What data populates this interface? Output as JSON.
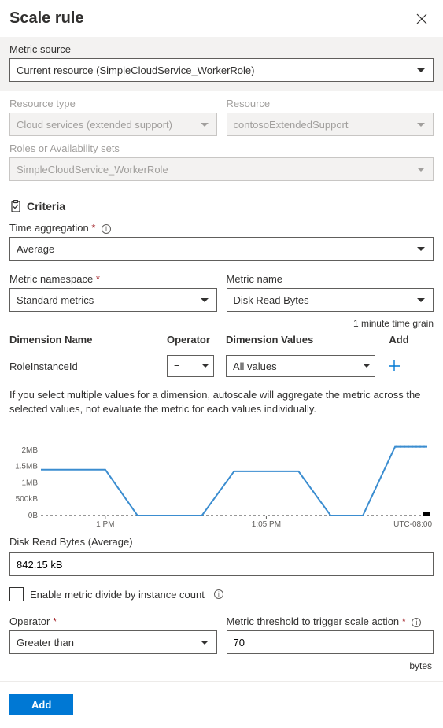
{
  "header": {
    "title": "Scale rule"
  },
  "metricSource": {
    "label": "Metric source",
    "value": "Current resource (SimpleCloudService_WorkerRole)"
  },
  "resourceType": {
    "label": "Resource type",
    "value": "Cloud services (extended support)"
  },
  "resource": {
    "label": "Resource",
    "value": "contosoExtendedSupport"
  },
  "roles": {
    "label": "Roles or Availability sets",
    "value": "SimpleCloudService_WorkerRole"
  },
  "criteria": {
    "title": "Criteria"
  },
  "timeAgg": {
    "label": "Time aggregation",
    "value": "Average"
  },
  "metricNs": {
    "label": "Metric namespace",
    "value": "Standard metrics"
  },
  "metricName": {
    "label": "Metric name",
    "value": "Disk Read Bytes"
  },
  "timeGrain": "1 minute time grain",
  "dimTable": {
    "headers": {
      "name": "Dimension Name",
      "op": "Operator",
      "values": "Dimension Values",
      "add": "Add"
    },
    "row": {
      "name": "RoleInstanceId",
      "op": "=",
      "values": "All values"
    }
  },
  "note": "If you select multiple values for a dimension, autoscale will aggregate the metric across the selected values, not evaluate the metric for each values individually.",
  "chart_data": {
    "type": "line",
    "title": "",
    "xlabel": "",
    "ylabel": "",
    "y_ticks": [
      "0B",
      "500kB",
      "1MB",
      "1.5MB",
      "2MB"
    ],
    "ylim": [
      0,
      2500000
    ],
    "x_ticks": [
      "1 PM",
      "1:05 PM"
    ],
    "tz": "UTC-08:00",
    "series": [
      {
        "name": "Disk Read Bytes",
        "points": [
          {
            "t": "12:58",
            "v": 1400000
          },
          {
            "t": "12:59",
            "v": 1400000
          },
          {
            "t": "1:00",
            "v": 1400000
          },
          {
            "t": "1:01",
            "v": 0
          },
          {
            "t": "1:02",
            "v": 0
          },
          {
            "t": "1:03",
            "v": 0
          },
          {
            "t": "1:04",
            "v": 1350000
          },
          {
            "t": "1:05",
            "v": 1350000
          },
          {
            "t": "1:06",
            "v": 1350000
          },
          {
            "t": "1:07",
            "v": 0
          },
          {
            "t": "1:08",
            "v": 0
          },
          {
            "t": "1:09",
            "v": 2100000
          },
          {
            "t": "1:10",
            "v": 2100000
          }
        ]
      }
    ]
  },
  "metricReadout": {
    "label": "Disk Read Bytes (Average)",
    "value": "842.15 kB"
  },
  "divideCheck": {
    "label": "Enable metric divide by instance count"
  },
  "operator": {
    "label": "Operator",
    "value": "Greater than"
  },
  "threshold": {
    "label": "Metric threshold to trigger scale action",
    "value": "70",
    "unit": "bytes"
  },
  "footer": {
    "add": "Add"
  }
}
